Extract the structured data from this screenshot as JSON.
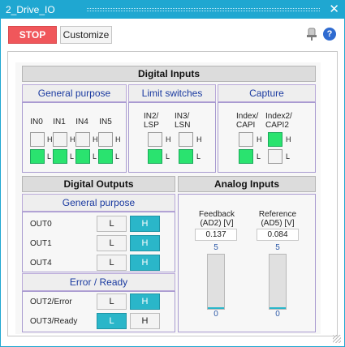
{
  "window": {
    "title": "2_Drive_IO",
    "close": "✕"
  },
  "toolbar": {
    "stop_label": "STOP",
    "customize_label": "Customize",
    "help": "?"
  },
  "digital_inputs": {
    "title": "Digital Inputs",
    "general_purpose": {
      "title": "General purpose",
      "pins": [
        "IN0",
        "IN1",
        "IN4",
        "IN5"
      ],
      "state": [
        "L",
        "L",
        "L",
        "L"
      ]
    },
    "limit_switches": {
      "title": "Limit switches",
      "pins": [
        "IN2/\nLSP",
        "IN3/\nLSN"
      ],
      "state": [
        "L",
        "L"
      ]
    },
    "capture": {
      "title": "Capture",
      "pins": [
        "Index/\nCAPI",
        "Index2/\nCAPI2"
      ],
      "state": [
        "L",
        "H"
      ]
    },
    "h": "H",
    "l": "L"
  },
  "digital_outputs": {
    "title": "Digital Outputs",
    "general_purpose": {
      "title": "General purpose",
      "rows": [
        {
          "label": "OUT0",
          "active": "H"
        },
        {
          "label": "OUT1",
          "active": "H"
        },
        {
          "label": "OUT4",
          "active": "H"
        }
      ]
    },
    "error_ready": {
      "title": "Error / Ready",
      "rows": [
        {
          "label": "OUT2/Error",
          "active": "H"
        },
        {
          "label": "OUT3/Ready",
          "active": "L"
        }
      ]
    },
    "l": "L",
    "h": "H"
  },
  "analog_inputs": {
    "title": "Analog Inputs",
    "channels": [
      {
        "label": "Feedback\n(AD2) [V]",
        "value": "0.137",
        "max": "5",
        "min": "0",
        "level": 0.027
      },
      {
        "label": "Reference\n(AD5) [V]",
        "value": "0.084",
        "max": "5",
        "min": "0",
        "level": 0.017
      }
    ]
  },
  "colors": {
    "accent": "#1fa7d1",
    "stop": "#f0575b",
    "on_input": "#2ae36f",
    "on_output": "#2ab6c9"
  }
}
